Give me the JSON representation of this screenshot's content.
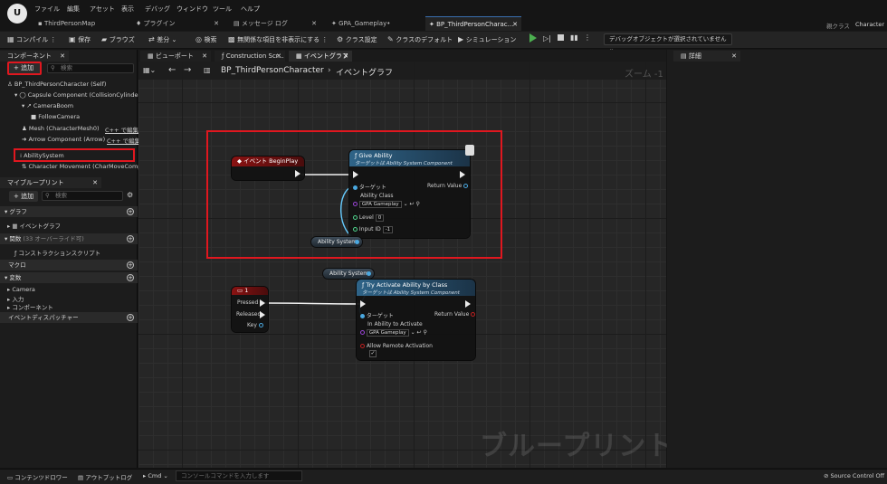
{
  "menu": [
    "ファイル",
    "編集",
    "アセット",
    "表示",
    "デバッグ",
    "ウィンドウ",
    "ツール",
    "ヘルプ"
  ],
  "tabs": [
    {
      "label": "ThirdPersonMap"
    },
    {
      "label": "プラグイン"
    },
    {
      "label": "メッセージ ログ"
    },
    {
      "label": "GPA_Gameplay•"
    },
    {
      "label": "BP_ThirdPersonCharac..."
    }
  ],
  "project_name": "Character",
  "project_prefix": "親クラス",
  "toolbar": {
    "compile": "コンパイル",
    "save": "保存",
    "browse": "ブラウズ",
    "diff": "差分",
    "find": "検索",
    "hide_unrelated": "無関係な項目を非表示にする",
    "class_settings": "クラス設定",
    "class_defaults": "クラスのデフォルト",
    "simulation": "シミュレーション",
    "debug_object": "デバッグオブジェクトが選択されていません"
  },
  "components_panel": {
    "tab": "コンポーネント",
    "add": "追加",
    "search_placeholder": "検索",
    "items": [
      {
        "label": "BP_ThirdPersonCharacter (Self)"
      },
      {
        "label": "Capsule Component (CollisionCylinder)"
      },
      {
        "label": "CameraBoom"
      },
      {
        "label": "FollowCamera"
      },
      {
        "label": "Mesh (CharacterMesh0)",
        "extra": "C++ で編集"
      },
      {
        "label": "Arrow Component (Arrow)",
        "extra": "C++ で編集"
      },
      {
        "label": "AbilitySystem"
      },
      {
        "label": "Character Movement (CharMoveComp)"
      }
    ]
  },
  "myblueprint_panel": {
    "tab": "マイブループリント",
    "add": "追加",
    "search_placeholder": "検索",
    "sections": {
      "graphs": "グラフ",
      "event_graph": "イベントグラフ",
      "functions": "関数",
      "functions_note": "(33 オーバーライド可)",
      "construction_script": "コンストラクションスクリプト",
      "macros": "マクロ",
      "variables": "変数",
      "var_camera": "Camera",
      "var_input": "入力",
      "var_components": "コンポーネント",
      "event_dispatchers": "イベントディスパッチャー"
    }
  },
  "graph_tabs": [
    "ビューポート",
    "Construction Scr...",
    "イベントグラフ"
  ],
  "breadcrumb": {
    "blueprint": "BP_ThirdPersonCharacter",
    "graph": "イベントグラフ"
  },
  "zoom": "ズーム -1",
  "watermark": "ブループリント",
  "nodes": {
    "begin_play": {
      "title": "イベント BeginPlay"
    },
    "give_ability": {
      "title": "Give Ability",
      "subtitle": "ターゲットは Ability System Component",
      "target": "ターゲット",
      "return_value": "Return Value",
      "ability_class": "Ability Class",
      "ability_class_value": "GPA Gameplay",
      "level": "Level",
      "level_value": "0",
      "input_id": "Input ID",
      "input_id_value": "-1"
    },
    "ability_system_var_1": {
      "label": "Ability System"
    },
    "ability_system_var_2": {
      "label": "Ability System"
    },
    "key_1": {
      "title": "1",
      "pressed": "Pressed",
      "released": "Released",
      "key": "Key"
    },
    "try_activate": {
      "title": "Try Activate Ability by Class",
      "subtitle": "ターゲットは Ability System Component",
      "target": "ターゲット",
      "return_value": "Return Value",
      "in_ability": "In Ability to Activate",
      "in_ability_value": "GPA Gameplay",
      "allow_remote": "Allow Remote Activation"
    }
  },
  "details_panel": {
    "tab": "詳細"
  },
  "statusbar": {
    "content_drawer": "コンテンツドロワー",
    "output_log": "アウトプットログ",
    "cmd": "Cmd",
    "console_placeholder": "コンソールコマンドを入力します",
    "source_control": "Source Control Off"
  },
  "colors": {
    "highlight": "#e0171f",
    "event_head": "#7a1010",
    "function_head": "#2c5a7c",
    "accent": "#3a6fb0"
  }
}
